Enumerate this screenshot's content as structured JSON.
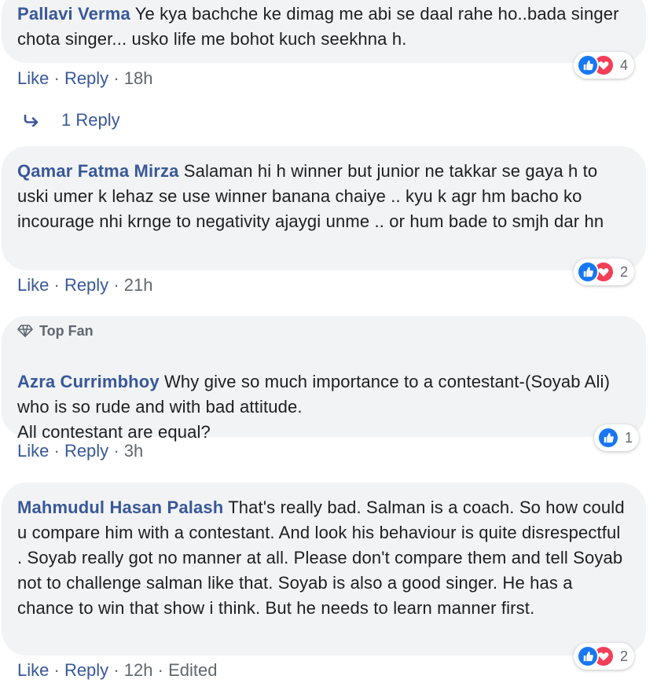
{
  "comments": [
    {
      "author": "Pallavi Verma",
      "text": "Ye kya bachche ke dimag me abi se daal rahe ho..bada singer chota singer... usko life me bohot kuch seekhna h.",
      "like_label": "Like",
      "reply_label": "Reply",
      "time": "18h",
      "reaction_count": "4",
      "reactions": [
        "like-icon",
        "love-icon"
      ]
    },
    {
      "author": "Qamar Fatma Mirza",
      "text": "Salaman hi h winner but junior ne takkar se gaya h to uski umer k lehaz se use winner banana chaiye .. kyu k agr hm bacho ko incourage nhi krnge to negativity ajaygi unme .. or hum bade to smjh dar hn",
      "like_label": "Like",
      "reply_label": "Reply",
      "time": "21h",
      "reaction_count": "2",
      "reactions": [
        "like-icon",
        "love-icon"
      ]
    },
    {
      "badge": "Top Fan",
      "author": "Azra Currimbhoy",
      "text": "Why give so much importance to a contestant-(Soyab Ali) who is so rude and with bad attitude.\nAll contestant are equal?",
      "like_label": "Like",
      "reply_label": "Reply",
      "time": "3h",
      "reaction_count": "1",
      "reactions": [
        "like-icon"
      ]
    },
    {
      "author": "Mahmudul Hasan Palash",
      "text": "That's really bad. Salman is a coach. So how could u compare him with a contestant. And look his behaviour is quite disrespectful . Soyab really got no manner at all. Please don't compare them and tell Soyab not to challenge salman like that. Soyab is also a good singer. He has a chance to win that show i think. But he needs to learn manner first.",
      "like_label": "Like",
      "reply_label": "Reply",
      "time": "12h",
      "edited": "Edited",
      "reaction_count": "2",
      "reactions": [
        "like-icon",
        "love-icon"
      ]
    }
  ],
  "replies_link": "1 Reply",
  "separator": "·",
  "colors": {
    "author": "#385898",
    "meta": "#606770",
    "bubble": "#f2f3f5",
    "like": "#1877f2",
    "love": "#f33e58"
  }
}
